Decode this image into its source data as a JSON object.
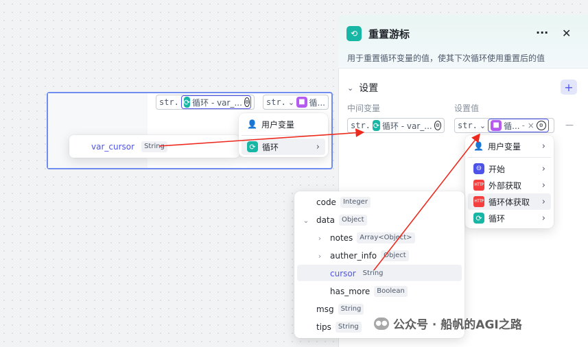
{
  "canvas": {
    "node_param_chip": {
      "type": "str.",
      "source": "循环 - var_..."
    },
    "node_value_chip": {
      "type": "str.",
      "source": "循..."
    },
    "output_var": {
      "name": "var_cursor",
      "type": "String"
    },
    "var_menu": {
      "items": [
        {
          "label": "用户变量",
          "icon": "user-icon"
        },
        {
          "label": "循环",
          "icon": "loop-icon"
        }
      ]
    }
  },
  "panel": {
    "title": "重置游标",
    "description": "用于重置循环变量的值，使其下次循环使用重置后的值",
    "section_title": "设置",
    "add_label": "+",
    "col_middle": "中间变量",
    "col_value": "设置值",
    "middle_chip": {
      "type": "str.",
      "source": "循环 - var_..."
    },
    "value_chip": {
      "type": "str.",
      "source": "循...",
      "suffix": "- ×"
    },
    "remove_label": "—",
    "more_label": "···",
    "close_label": "✕"
  },
  "source_menu": {
    "items": [
      {
        "label": "用户变量",
        "icon": "user-icon"
      },
      {
        "label": "开始",
        "icon": "start-icon"
      },
      {
        "label": "外部获取",
        "icon": "http-icon"
      },
      {
        "label": "循环体获取",
        "icon": "http-icon"
      },
      {
        "label": "循环",
        "icon": "loop-icon"
      }
    ]
  },
  "tree": [
    {
      "name": "code",
      "type": "Integer",
      "level": 0,
      "toggle": ""
    },
    {
      "name": "data",
      "type": "Object",
      "level": 0,
      "toggle": "⌄"
    },
    {
      "name": "notes",
      "type": "Array<Object>",
      "level": 1,
      "toggle": "›"
    },
    {
      "name": "auther_info",
      "type": "Object",
      "level": 1,
      "toggle": "›"
    },
    {
      "name": "cursor",
      "type": "String",
      "level": 1,
      "toggle": ""
    },
    {
      "name": "has_more",
      "type": "Boolean",
      "level": 1,
      "toggle": ""
    },
    {
      "name": "msg",
      "type": "String",
      "level": 0,
      "toggle": ""
    },
    {
      "name": "tips",
      "type": "String",
      "level": 0,
      "toggle": ""
    }
  ],
  "watermark": "公众号 · 船帆的AGI之路",
  "colors": {
    "accent": "#4d53e8",
    "teal": "#17b6a5",
    "purple": "#b65bef",
    "arrow": "#ee2a1f"
  }
}
